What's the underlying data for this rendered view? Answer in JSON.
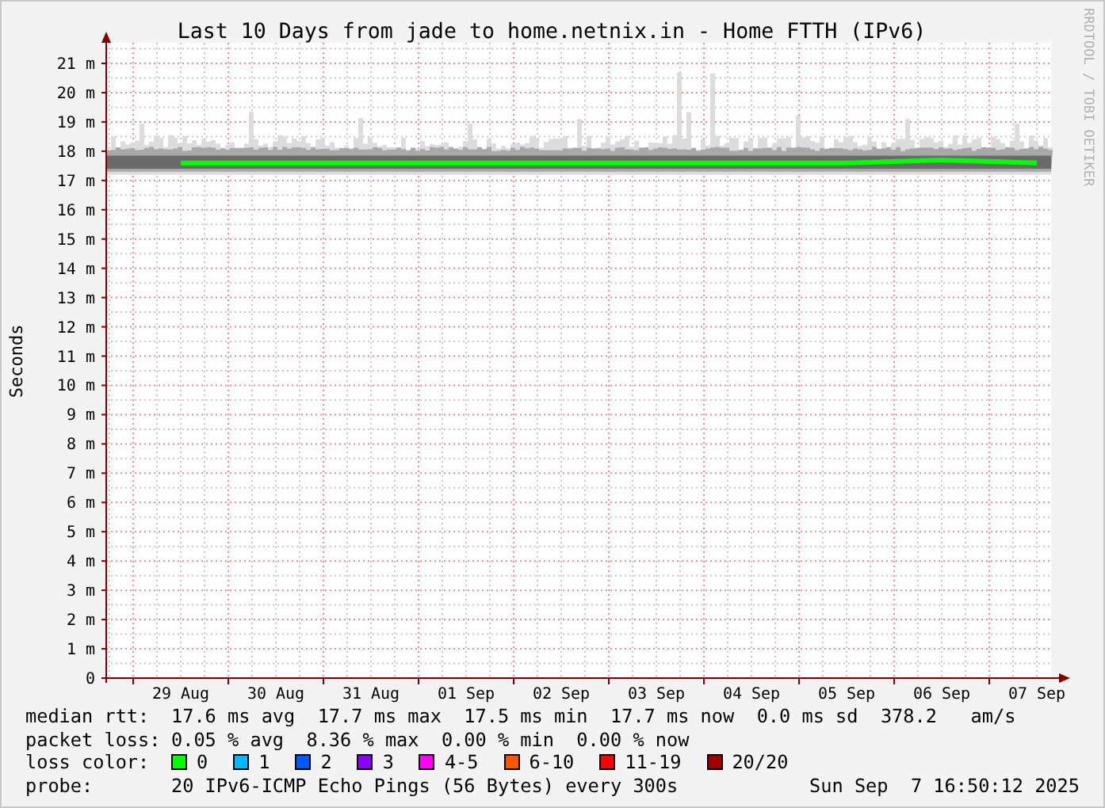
{
  "title": "Last 10 Days from jade to home.netnix.in - Home FTTH (IPv6)",
  "watermark_side": "RRDTOOL / TOBI OETIKER",
  "chart_data": {
    "type": "line",
    "ylabel": "Seconds",
    "categories": [
      "29 Aug",
      "30 Aug",
      "31 Aug",
      "01 Sep",
      "02 Sep",
      "03 Sep",
      "04 Sep",
      "05 Sep",
      "06 Sep",
      "07 Sep"
    ],
    "grid": true,
    "series": [
      {
        "color": "#00ff00",
        "values": [
          17.6,
          17.6,
          17.6,
          17.6,
          17.6,
          17.6,
          17.6,
          17.6,
          17.7,
          17.6
        ]
      }
    ],
    "ylim": [
      0,
      21
    ],
    "yticks": [
      {
        "value": 0,
        "label": "0"
      },
      {
        "value": 1,
        "label": "1 m"
      },
      {
        "value": 2,
        "label": "2 m"
      },
      {
        "value": 3,
        "label": "3 m"
      },
      {
        "value": 4,
        "label": "4 m"
      },
      {
        "value": 5,
        "label": "5 m"
      },
      {
        "value": 6,
        "label": "6 m"
      },
      {
        "value": 7,
        "label": "7 m"
      },
      {
        "value": 8,
        "label": "8 m"
      },
      {
        "value": 9,
        "label": "9 m"
      },
      {
        "value": 10,
        "label": "10 m"
      },
      {
        "value": 11,
        "label": "11 m"
      },
      {
        "value": 12,
        "label": "12 m"
      },
      {
        "value": 13,
        "label": "13 m"
      },
      {
        "value": 14,
        "label": "14 m"
      },
      {
        "value": 15,
        "label": "15 m"
      },
      {
        "value": 16,
        "label": "16 m"
      },
      {
        "value": 17,
        "label": "17 m"
      },
      {
        "value": 18,
        "label": "18 m"
      },
      {
        "value": 19,
        "label": "19 m"
      },
      {
        "value": 20,
        "label": "20 m"
      },
      {
        "value": 21,
        "label": "21 m"
      }
    ]
  },
  "legend": {
    "median_rtt": {
      "label": "median rtt:",
      "text": "17.6 ms avg  17.7 ms max  17.5 ms min  17.7 ms now  0.0 ms sd  378.2   am/s"
    },
    "packet_loss": {
      "label": "packet loss:",
      "text": "0.05 % avg  8.36 % max  0.00 % min  0.00 % now"
    },
    "loss_color": {
      "label": "loss color:",
      "items": [
        {
          "label": "0",
          "color": "#00ff00"
        },
        {
          "label": "1",
          "color": "#00b8ff"
        },
        {
          "label": "2",
          "color": "#0059ff"
        },
        {
          "label": "3",
          "color": "#8a00ff"
        },
        {
          "label": "4-5",
          "color": "#ff00ff"
        },
        {
          "label": "6-10",
          "color": "#ff5500"
        },
        {
          "label": "11-19",
          "color": "#ff0000"
        },
        {
          "label": "20/20",
          "color": "#a10000"
        }
      ]
    },
    "probe": {
      "label": "probe:",
      "text": "20 IPv6-ICMP Echo Pings (56 Bytes) every 300s",
      "timestamp": "Sun Sep  7 16:50:12 2025"
    }
  }
}
